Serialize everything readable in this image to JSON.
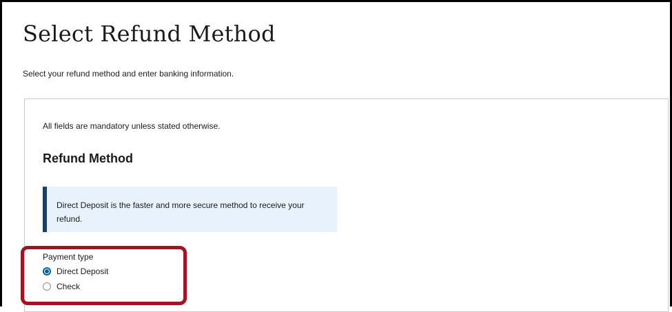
{
  "page": {
    "title": "Select Refund Method",
    "subtitle": "Select your refund method and enter banking information."
  },
  "form": {
    "mandatory_note": "All fields are mandatory unless stated otherwise.",
    "section_heading": "Refund Method",
    "info_alert": "Direct Deposit is the faster and more secure method to receive your refund.",
    "payment_type": {
      "legend": "Payment type",
      "options": [
        {
          "label": "Direct Deposit",
          "selected": true
        },
        {
          "label": "Check",
          "selected": false
        }
      ]
    }
  },
  "colors": {
    "alert_background": "#e7f2fd",
    "alert_border": "#1c3f66",
    "radio_accent": "#005ea2",
    "highlight": "#a11523"
  }
}
